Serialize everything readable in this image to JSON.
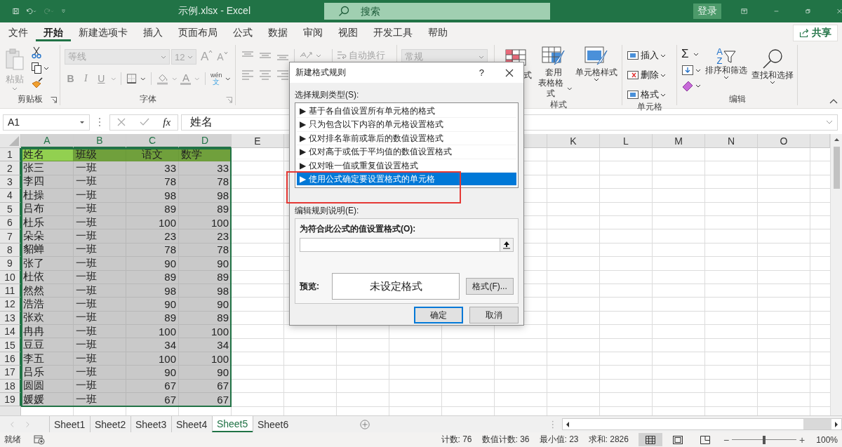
{
  "window": {
    "title": "示例.xlsx  -  Excel",
    "search": {
      "placeholder": "搜索"
    },
    "sign_in": "登录"
  },
  "tabs": [
    {
      "label": "文件",
      "selected": false
    },
    {
      "label": "开始",
      "selected": true
    },
    {
      "label": "新建选项卡",
      "selected": false
    },
    {
      "label": "插入",
      "selected": false
    },
    {
      "label": "页面布局",
      "selected": false
    },
    {
      "label": "公式",
      "selected": false
    },
    {
      "label": "数据",
      "selected": false
    },
    {
      "label": "审阅",
      "selected": false
    },
    {
      "label": "视图",
      "selected": false
    },
    {
      "label": "开发工具",
      "selected": false
    },
    {
      "label": "帮助",
      "selected": false
    }
  ],
  "share": "共享",
  "ribbon": {
    "clipboard": {
      "paste": "粘贴",
      "disabled": true,
      "label": "剪贴板"
    },
    "font": {
      "disabled": true,
      "font_name": "等线",
      "font_size": "12",
      "grow": "A",
      "shrink": "A",
      "styles": [
        "B",
        "I",
        "U"
      ],
      "font_color": "A",
      "phonetic_top": "wén",
      "phonetic_bottom": "文",
      "label": "字体"
    },
    "alignment": {
      "disabled": true,
      "wrap_text": "自动换行"
    },
    "number": {
      "disabled": true,
      "format": "常规"
    },
    "styles": {
      "conditional": "式",
      "table_top": "套用",
      "table_bottom": "表格格式",
      "cell_styles": "单元格样式",
      "label": "样式"
    },
    "cells": {
      "items": [
        "插入",
        "删除",
        "格式"
      ],
      "label": "单元格"
    },
    "editing": {
      "autosum": "Σ",
      "sort_letters": [
        "A",
        "Z"
      ],
      "sort": "排序和筛选",
      "find": "查找和选择",
      "label": "编辑"
    }
  },
  "formula_bar": {
    "name_box": "A1",
    "function_label": "fx",
    "value": "姓名"
  },
  "sheet": {
    "columns_left": [
      {
        "letter": "A",
        "selected": true
      },
      {
        "letter": "B",
        "selected": true
      },
      {
        "letter": "C",
        "selected": true
      },
      {
        "letter": "D",
        "selected": true
      },
      {
        "letter": "E",
        "selected": false
      }
    ],
    "columns_right": [
      {
        "letter": "K",
        "selected": false
      },
      {
        "letter": "L",
        "selected": false
      },
      {
        "letter": "M",
        "selected": false
      },
      {
        "letter": "N",
        "selected": false
      },
      {
        "letter": "O",
        "selected": false
      }
    ],
    "rows": [
      {
        "number": "1",
        "kind": "header",
        "selected": true,
        "cells": [
          {
            "text": "姓名",
            "centered": false,
            "active": true
          },
          {
            "text": "班级",
            "centered": false,
            "active": false
          },
          {
            "text": "语文",
            "centered": true,
            "active": false
          },
          {
            "text": "数学",
            "centered": false,
            "active": false
          }
        ]
      },
      {
        "number": "2",
        "kind": "data",
        "selected": true,
        "cells": [
          "张三",
          "一班",
          "33",
          "33"
        ]
      },
      {
        "number": "3",
        "kind": "data",
        "selected": true,
        "cells": [
          "李四",
          "一班",
          "78",
          "78"
        ]
      },
      {
        "number": "4",
        "kind": "data",
        "selected": true,
        "cells": [
          "杜操",
          "一班",
          "98",
          "98"
        ]
      },
      {
        "number": "5",
        "kind": "data",
        "selected": true,
        "cells": [
          "吕布",
          "一班",
          "89",
          "89"
        ]
      },
      {
        "number": "6",
        "kind": "data",
        "selected": true,
        "cells": [
          "杜乐",
          "一班",
          "100",
          "100"
        ]
      },
      {
        "number": "7",
        "kind": "data",
        "selected": true,
        "cells": [
          "朵朵",
          "一班",
          "23",
          "23"
        ]
      },
      {
        "number": "8",
        "kind": "data",
        "selected": true,
        "cells": [
          "貂蝉",
          "一班",
          "78",
          "78"
        ]
      },
      {
        "number": "9",
        "kind": "data",
        "selected": true,
        "cells": [
          "张了",
          "一班",
          "90",
          "90"
        ]
      },
      {
        "number": "10",
        "kind": "data",
        "selected": true,
        "cells": [
          "杜依",
          "一班",
          "89",
          "89"
        ]
      },
      {
        "number": "11",
        "kind": "data",
        "selected": true,
        "cells": [
          "然然",
          "一班",
          "98",
          "98"
        ]
      },
      {
        "number": "12",
        "kind": "data",
        "selected": true,
        "cells": [
          "浩浩",
          "一班",
          "90",
          "90"
        ]
      },
      {
        "number": "13",
        "kind": "data",
        "selected": true,
        "cells": [
          "张欢",
          "一班",
          "89",
          "89"
        ]
      },
      {
        "number": "14",
        "kind": "data",
        "selected": true,
        "cells": [
          "冉冉",
          "一班",
          "100",
          "100"
        ]
      },
      {
        "number": "15",
        "kind": "data",
        "selected": true,
        "cells": [
          "豆豆",
          "一班",
          "34",
          "34"
        ]
      },
      {
        "number": "16",
        "kind": "data",
        "selected": true,
        "cells": [
          "李五",
          "一班",
          "100",
          "100"
        ]
      },
      {
        "number": "17",
        "kind": "data",
        "selected": true,
        "cells": [
          "吕乐",
          "一班",
          "90",
          "90"
        ]
      },
      {
        "number": "18",
        "kind": "data",
        "selected": true,
        "cells": [
          "圆圆",
          "一班",
          "67",
          "67"
        ]
      },
      {
        "number": "19",
        "kind": "data",
        "selected": true,
        "cells": [
          "媛媛",
          "一班",
          "67",
          "67"
        ]
      }
    ]
  },
  "sheet_tabs": [
    {
      "label": "Sheet1",
      "selected": false
    },
    {
      "label": "Sheet2",
      "selected": false
    },
    {
      "label": "Sheet3",
      "selected": false
    },
    {
      "label": "Sheet4",
      "selected": false
    },
    {
      "label": "Sheet5",
      "selected": true
    },
    {
      "label": "Sheet6",
      "selected": false
    }
  ],
  "status_bar": {
    "ready": "就绪",
    "stats": [
      "计数: 76",
      "数值计数: 36",
      "最小值: 23",
      "求和: 2826"
    ],
    "views": [
      {
        "kind": "normal",
        "selected": true
      },
      {
        "kind": "page_layout",
        "selected": false
      },
      {
        "kind": "page_break",
        "selected": false
      }
    ],
    "zoom": {
      "minus": "−",
      "plus": "+",
      "level": 0.5,
      "reading": "100%"
    }
  },
  "dialog": {
    "title": "新建格式规则",
    "help": "?",
    "rule_type_label": "选择规则类型(S):",
    "rule_types": [
      {
        "label": "▶ 基于各自值设置所有单元格的格式",
        "selected": false
      },
      {
        "label": "▶ 只为包含以下内容的单元格设置格式",
        "selected": false
      },
      {
        "label": "▶ 仅对排名靠前或靠后的数值设置格式",
        "selected": false
      },
      {
        "label": "▶ 仅对高于或低于平均值的数值设置格式",
        "selected": false
      },
      {
        "label": "▶ 仅对唯一值或重复值设置格式",
        "selected": false
      },
      {
        "label": "▶ 使用公式确定要设置格式的单元格",
        "selected": true
      }
    ],
    "description_label": "编辑规则说明(E):",
    "formula_label": "为符合此公式的值设置格式(O):",
    "preview_label": "预览:",
    "preview_text": "未设定格式",
    "format_button": "格式(F)...",
    "ok": "确定",
    "cancel": "取消"
  },
  "annotation": {
    "kind": "highlight_frame"
  }
}
